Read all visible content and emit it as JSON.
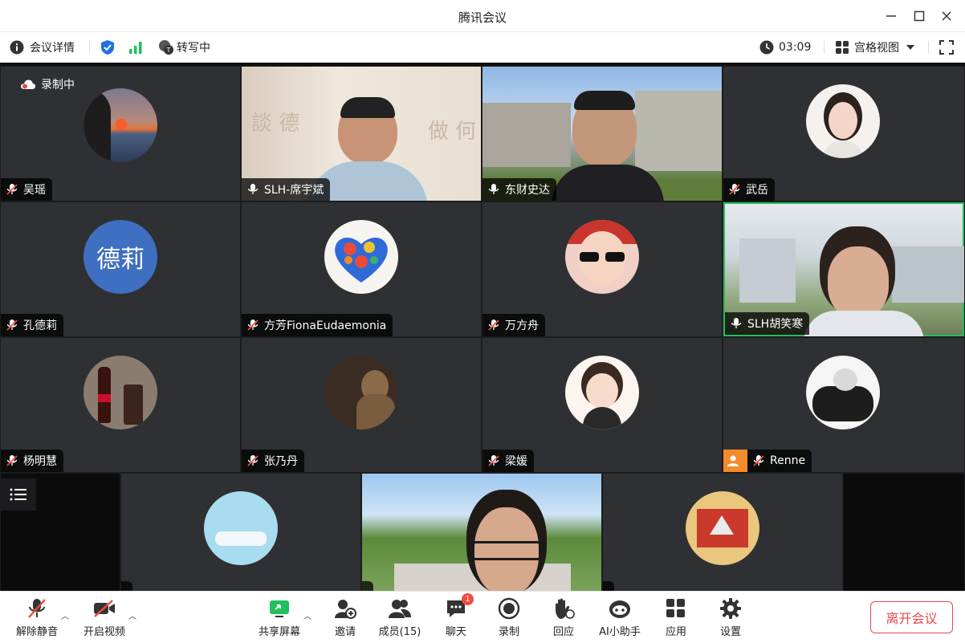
{
  "window": {
    "title": "腾讯会议"
  },
  "infobar": {
    "meeting_details": "会议详情",
    "transcribing": "转写中",
    "timer": "03:09",
    "view_mode": "宫格视图"
  },
  "recording_label": "录制中",
  "participants": [
    {
      "name": "吴瑶",
      "muted": true
    },
    {
      "name": "SLH-席宇斌",
      "muted": false
    },
    {
      "name": "东财史达",
      "muted": false
    },
    {
      "name": "武岳",
      "muted": true
    },
    {
      "name": "孔德莉",
      "muted": true,
      "avatar_text": "德莉"
    },
    {
      "name": "方芳FionaEudaemonia",
      "muted": true
    },
    {
      "name": "万方舟",
      "muted": true
    },
    {
      "name": "SLH胡笑寒",
      "muted": false,
      "speaking": true
    },
    {
      "name": "杨明慧",
      "muted": true
    },
    {
      "name": "张乃丹",
      "muted": true
    },
    {
      "name": "梁媛",
      "muted": true
    },
    {
      "name": "Renne",
      "muted": true
    }
  ],
  "toolbar": {
    "unmute": "解除静音",
    "start_video": "开启视频",
    "share_screen": "共享屏幕",
    "invite": "邀请",
    "members": "成员(15)",
    "chat": "聊天",
    "chat_badge": "1",
    "record": "录制",
    "reactions": "回应",
    "ai_assistant": "AI小助手",
    "apps": "应用",
    "settings": "设置",
    "leave": "离开会议"
  },
  "colors": {
    "speaking_border": "#1ec15b",
    "leave_red": "#e5494a",
    "tile_bg": "#2f3033",
    "avatar_blue": "#3e6fc0"
  }
}
